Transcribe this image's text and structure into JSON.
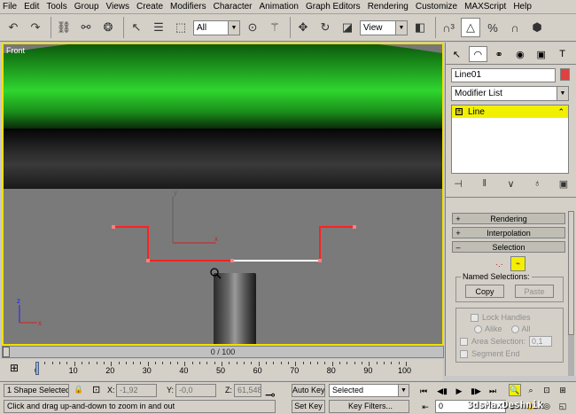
{
  "menu": [
    "File",
    "Edit",
    "Tools",
    "Group",
    "Views",
    "Create",
    "Modifiers",
    "Character",
    "Animation",
    "Graph Editors",
    "Rendering",
    "Customize",
    "MAXScript",
    "Help"
  ],
  "toolbar": {
    "selection_filter": "All",
    "ref_coord": "View"
  },
  "viewport": {
    "label": "Front",
    "active_border_color": "#f0e000",
    "spline_color": "#ff2020"
  },
  "command_panel": {
    "object_name": "Line01",
    "object_color": "#e04040",
    "modifier_list": "Modifier List",
    "stack_item": "Line",
    "rollouts": {
      "rendering": "Rendering",
      "interpolation": "Interpolation",
      "selection": "Selection"
    },
    "named_selections": {
      "title": "Named Selections:",
      "copy": "Copy",
      "paste": "Paste"
    },
    "lock_handles": "Lock Handles",
    "alike": "Alike",
    "all": "All",
    "area_selection": "Area Selection:",
    "area_value": "0,1",
    "segment_end": "Segment End"
  },
  "time_slider": {
    "label": "0 / 100",
    "current_frame": 0,
    "total_frames": 100
  },
  "trackbar": {
    "ticks": [
      "0",
      "10",
      "20",
      "30",
      "40",
      "50",
      "60",
      "70",
      "80",
      "90",
      "100"
    ]
  },
  "status": {
    "selection": "1 Shape Selected",
    "x_label": "X:",
    "x_value": "-1,92",
    "y_label": "Y:",
    "y_value": "-0,0",
    "z_label": "Z:",
    "z_value": "61,548",
    "prompt": "Click and drag up-and-down to zoom in and out",
    "auto_key": "Auto Key",
    "set_key": "Set Key",
    "key_mode": "Selected",
    "key_filters": "Key Filters...",
    "frame": "0"
  },
  "watermark": "3dsMaxDeshnik"
}
